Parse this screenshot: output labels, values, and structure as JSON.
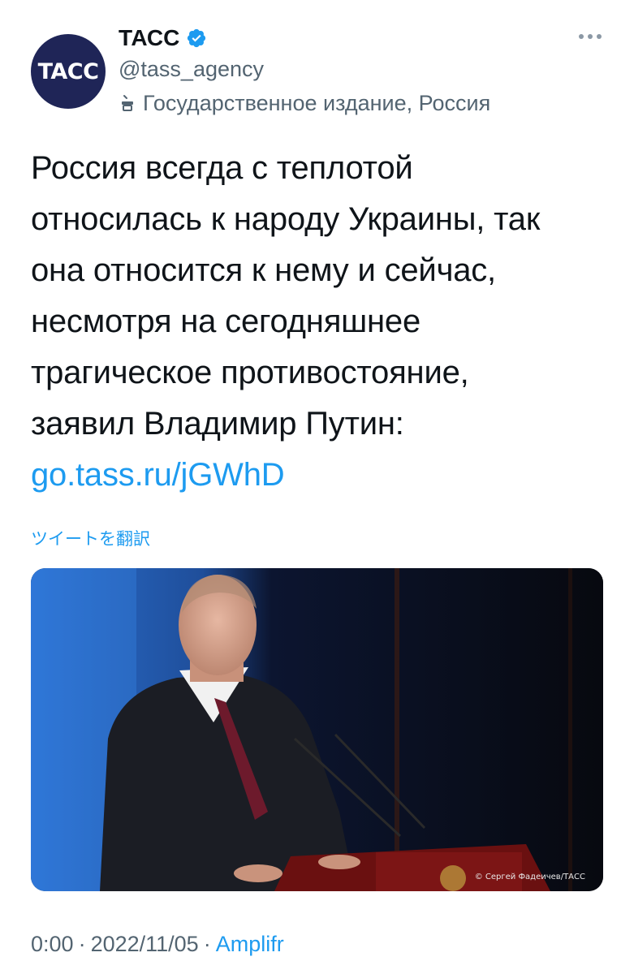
{
  "account": {
    "avatar_text": "TACC",
    "name": "ТАСС",
    "handle": "@tass_agency",
    "label": "Государственное издание, Россия"
  },
  "tweet": {
    "lines": [
      "Россия всегда с теплотой",
      "относилась к народу Украины, так",
      "она относится к нему и сейчас,",
      "несмотря на сегодняшнее",
      "трагическое противостояние,",
      "заявил Владимир Путин:"
    ],
    "link": "go.tass.ru/jGWhD",
    "translate": "ツイートを翻訳"
  },
  "media": {
    "credit": "© Сергей Фадеичев/ТАСС"
  },
  "meta": {
    "time": "0:00",
    "date": "2022/11/05",
    "source": "Amplifr"
  },
  "colors": {
    "link": "#1d9bf0",
    "verified": "#1d9bf0",
    "avatar": "#1f2557",
    "secondary_text": "#536471"
  }
}
